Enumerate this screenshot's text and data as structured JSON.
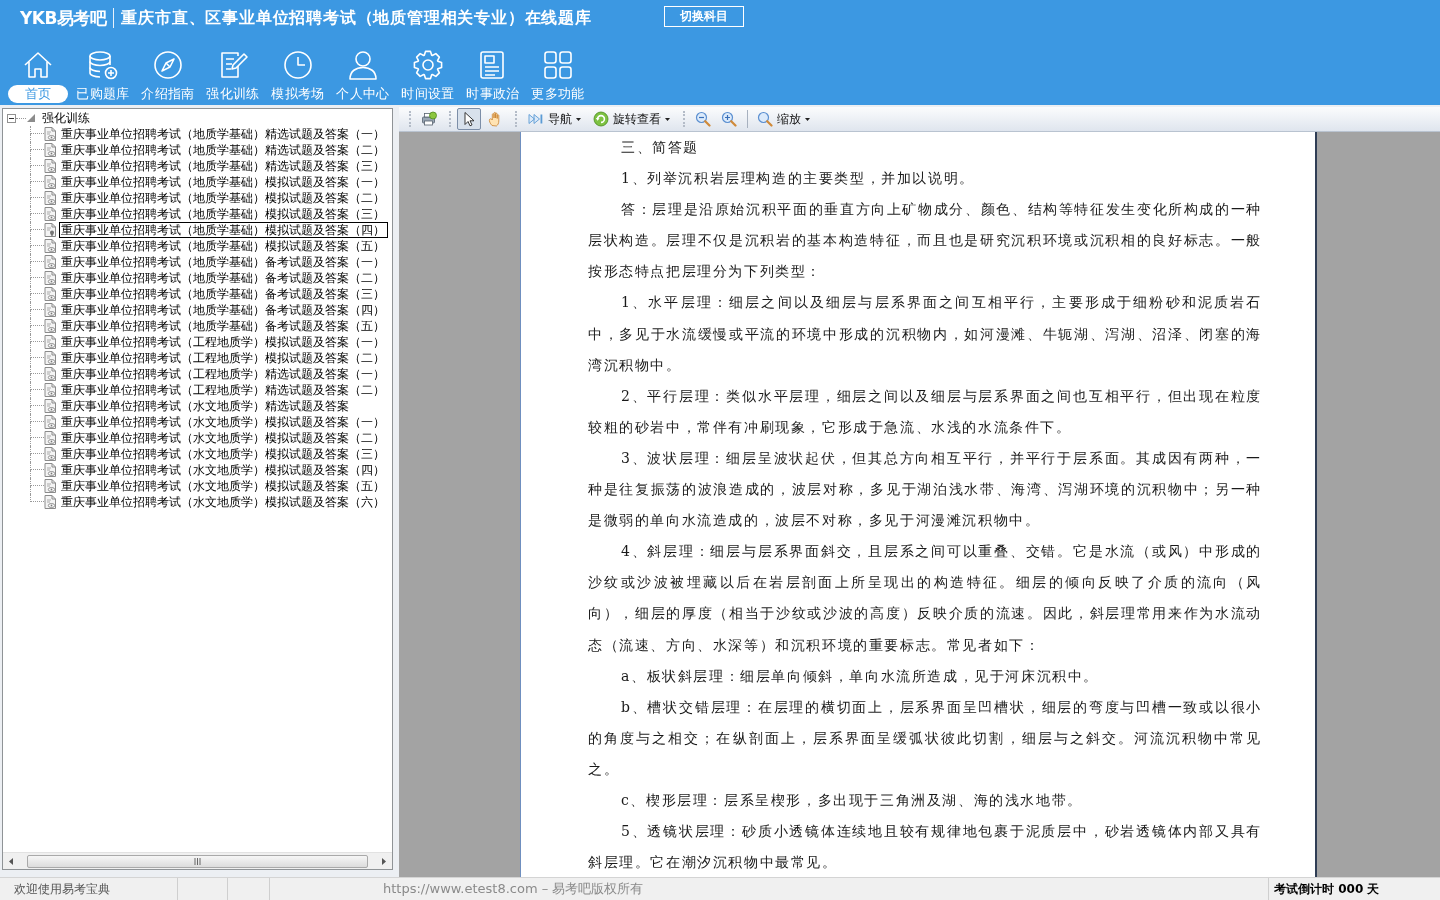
{
  "header": {
    "logo": "YKB易考吧",
    "title": "重庆市直、区事业单位招聘考试（地质管理相关专业）在线题库",
    "switch_button": "切换科目"
  },
  "nav": [
    {
      "label": "首页",
      "selected": true
    },
    {
      "label": "已购题库",
      "selected": false
    },
    {
      "label": "介绍指南",
      "selected": false
    },
    {
      "label": "强化训练",
      "selected": false
    },
    {
      "label": "模拟考场",
      "selected": false
    },
    {
      "label": "个人中心",
      "selected": false
    },
    {
      "label": "时间设置",
      "selected": false
    },
    {
      "label": "时事政治",
      "selected": false
    },
    {
      "label": "更多功能",
      "selected": false
    }
  ],
  "tree": {
    "label": "强化训练",
    "expanded": true,
    "children": [
      {
        "label": "重庆事业单位招聘考试（地质学基础）精选试题及答案（一）",
        "selected": false
      },
      {
        "label": "重庆事业单位招聘考试（地质学基础）精选试题及答案（二）",
        "selected": false
      },
      {
        "label": "重庆事业单位招聘考试（地质学基础）精选试题及答案（三）",
        "selected": false
      },
      {
        "label": "重庆事业单位招聘考试（地质学基础）模拟试题及答案（一）",
        "selected": false
      },
      {
        "label": "重庆事业单位招聘考试（地质学基础）模拟试题及答案（二）",
        "selected": false
      },
      {
        "label": "重庆事业单位招聘考试（地质学基础）模拟试题及答案（三）",
        "selected": false
      },
      {
        "label": "重庆事业单位招聘考试（地质学基础）模拟试题及答案（四）",
        "selected": true
      },
      {
        "label": "重庆事业单位招聘考试（地质学基础）模拟试题及答案（五）",
        "selected": false
      },
      {
        "label": "重庆事业单位招聘考试（地质学基础）备考试题及答案（一）",
        "selected": false
      },
      {
        "label": "重庆事业单位招聘考试（地质学基础）备考试题及答案（二）",
        "selected": false
      },
      {
        "label": "重庆事业单位招聘考试（地质学基础）备考试题及答案（三）",
        "selected": false
      },
      {
        "label": "重庆事业单位招聘考试（地质学基础）备考试题及答案（四）",
        "selected": false
      },
      {
        "label": "重庆事业单位招聘考试（地质学基础）备考试题及答案（五）",
        "selected": false
      },
      {
        "label": "重庆事业单位招聘考试（工程地质学）模拟试题及答案（一）",
        "selected": false
      },
      {
        "label": "重庆事业单位招聘考试（工程地质学）模拟试题及答案（二）",
        "selected": false
      },
      {
        "label": "重庆事业单位招聘考试（工程地质学）精选试题及答案（一）",
        "selected": false
      },
      {
        "label": "重庆事业单位招聘考试（工程地质学）精选试题及答案（二）",
        "selected": false
      },
      {
        "label": "重庆事业单位招聘考试（水文地质学）精选试题及答案",
        "selected": false
      },
      {
        "label": "重庆事业单位招聘考试（水文地质学）模拟试题及答案（一）",
        "selected": false
      },
      {
        "label": "重庆事业单位招聘考试（水文地质学）模拟试题及答案（二）",
        "selected": false
      },
      {
        "label": "重庆事业单位招聘考试（水文地质学）模拟试题及答案（三）",
        "selected": false
      },
      {
        "label": "重庆事业单位招聘考试（水文地质学）模拟试题及答案（四）",
        "selected": false
      },
      {
        "label": "重庆事业单位招聘考试（水文地质学）模拟试题及答案（五）",
        "selected": false
      },
      {
        "label": "重庆事业单位招聘考试（水文地质学）模拟试题及答案（六）",
        "selected": false
      }
    ]
  },
  "toolbar": {
    "tools": [
      {
        "selected": true
      },
      {
        "selected": false
      }
    ],
    "menus": [
      {
        "label": "导航"
      },
      {
        "label": "旋转查看"
      },
      {
        "label": "缩放"
      }
    ]
  },
  "document": {
    "paragraphs": [
      "三、简答题",
      "1、列举沉积岩层理构造的主要类型，并加以说明。",
      "答：层理是沿原始沉积平面的垂直方向上矿物成分、颜色、结构等特征发生变化所构成的一种层状构造。层理不仅是沉积岩的基本构造特征，而且也是研究沉积环境或沉积相的良好标志。一般按形态特点把层理分为下列类型：",
      "1、水平层理：细层之间以及细层与层系界面之间互相平行，主要形成于细粉砂和泥质岩石中，多见于水流缓慢或平流的环境中形成的沉积物内，如河漫滩、牛轭湖、泻湖、沼泽、闭塞的海湾沉积物中。",
      "2、平行层理：类似水平层理，细层之间以及细层与层系界面之间也互相平行，但出现在粒度较粗的砂岩中，常伴有冲刷现象，它形成于急流、水浅的水流条件下。",
      "3、波状层理：细层呈波状起伏，但其总方向相互平行，并平行于层系面。其成因有两种，一种是往复振荡的波浪造成的，波层对称，多见于湖泊浅水带、海湾、泻湖环境的沉积物中；另一种是微弱的单向水流造成的，波层不对称，多见于河漫滩沉积物中。",
      "4、斜层理：细层与层系界面斜交，且层系之间可以重叠、交错。它是水流（或风）中形成的沙纹或沙波被埋藏以后在岩层剖面上所呈现出的构造特征。细层的倾向反映了介质的流向（风向），细层的厚度（相当于沙纹或沙波的高度）反映介质的流速。因此，斜层理常用来作为水流动态（流速、方向、水深等）和沉积环境的重要标志。常见者如下：",
      "a、板状斜层理：细层单向倾斜，单向水流所造成，见于河床沉积中。",
      "b、槽状交错层理：在层理的横切面上，层系界面呈凹槽状，细层的弯度与凹槽一致或以很小的角度与之相交；在纵剖面上，层系界面呈缓弧状彼此切割，细层与之斜交。河流沉积物中常见之。",
      "c、楔形层理：层系呈楔形，多出现于三角洲及湖、海的浅水地带。",
      "5、透镜状层理：砂质小透镜体连续地且较有规律地包裹于泥质层中，砂岩透镜体内部又具有斜层理。它在潮汐沉积物中最常见。"
    ]
  },
  "status_bar": {
    "welcome": "欢迎使用易考宝典",
    "copyright": "https://www.etest8.com – 易考吧版权所有",
    "countdown": "考试倒计时 000 天"
  }
}
